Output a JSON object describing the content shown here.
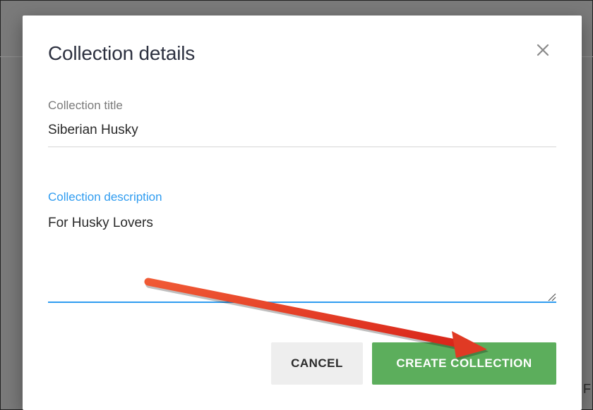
{
  "dialog": {
    "title": "Collection details",
    "close_icon": "close-icon",
    "fields": {
      "title": {
        "label": "Collection title",
        "value": "Siberian Husky"
      },
      "description": {
        "label": "Collection description",
        "value": "For Husky Lovers"
      }
    },
    "buttons": {
      "cancel": "CANCEL",
      "create": "CREATE COLLECTION"
    }
  },
  "background": {
    "peek_text": "F"
  },
  "colors": {
    "accent_blue": "#2f9cf0",
    "create_green": "#5cae5c",
    "cancel_gray": "#eeeeee",
    "arrow_red": "#e8321e"
  },
  "annotation": {
    "icon": "red-arrow-annotation"
  }
}
